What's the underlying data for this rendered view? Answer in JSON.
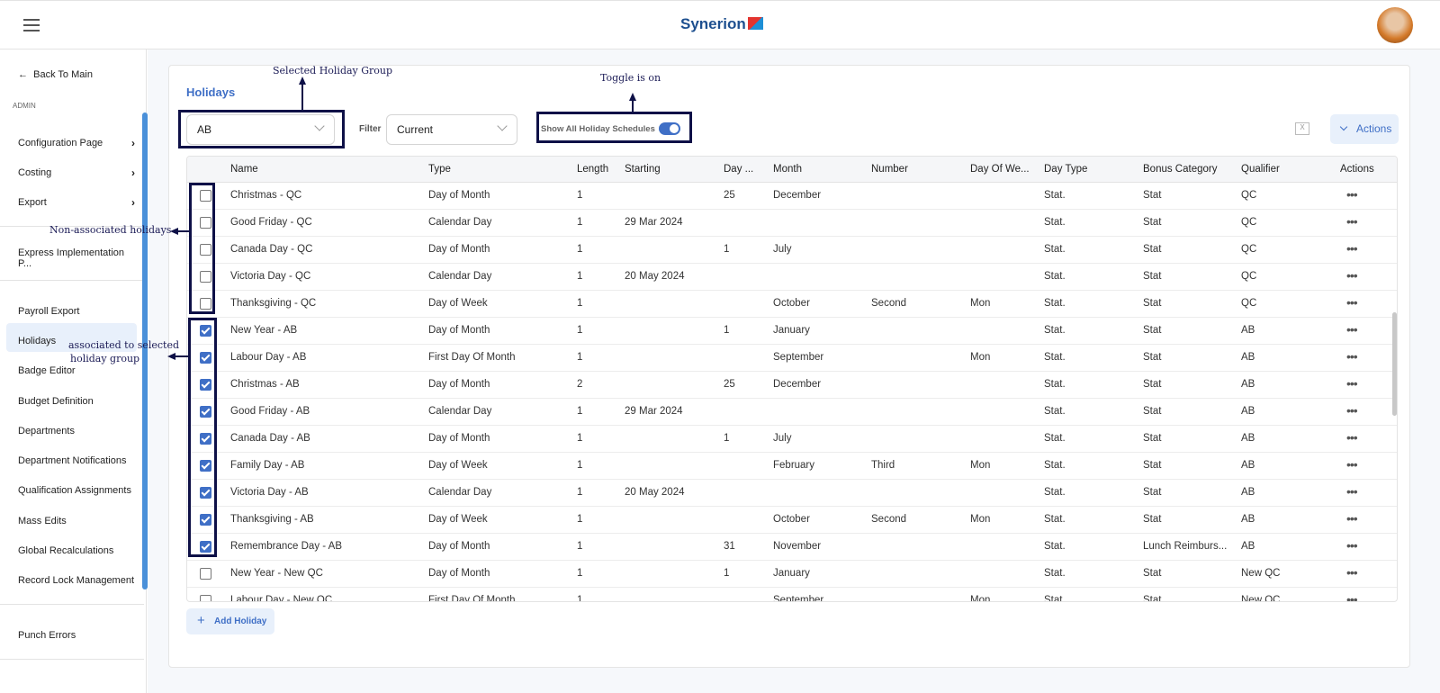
{
  "header": {
    "logo": "Synerion"
  },
  "sidebar": {
    "back": "Back To Main",
    "section": "ADMIN",
    "items": [
      {
        "label": "Configuration Page",
        "chev": "›"
      },
      {
        "label": "Costing",
        "chev": "›"
      },
      {
        "label": "Export",
        "chev": "›"
      },
      {
        "label": "Express Implementation P..."
      },
      {
        "label": "Payroll Export"
      },
      {
        "label": "Holidays"
      },
      {
        "label": "Badge Editor"
      },
      {
        "label": "Budget Definition"
      },
      {
        "label": "Departments"
      },
      {
        "label": "Department Notifications"
      },
      {
        "label": "Qualification Assignments"
      },
      {
        "label": "Mass Edits"
      },
      {
        "label": "Global Recalculations"
      },
      {
        "label": "Record Lock Management"
      },
      {
        "label": "Punch Errors"
      }
    ]
  },
  "page": {
    "title": "Holidays",
    "group": "AB",
    "filter_label": "Filter",
    "filter": "Current",
    "toggle_label": "Show All Holiday Schedules",
    "toggle_on": true,
    "actions": "Actions",
    "add": "Add Holiday",
    "excel": "X"
  },
  "table": {
    "columns": [
      "Name",
      "Type",
      "Length",
      "Starting",
      "Day ...",
      "Month",
      "Number",
      "Day Of We...",
      "Day Type",
      "Bonus Category",
      "Qualifier",
      "Actions"
    ],
    "rows": [
      {
        "checked": false,
        "c": [
          "Christmas - QC",
          "Day of Month",
          "1",
          "",
          "25",
          "December",
          "",
          "",
          "Stat.",
          "Stat",
          "QC"
        ]
      },
      {
        "checked": false,
        "c": [
          "Good Friday - QC",
          "Calendar Day",
          "1",
          "29 Mar 2024",
          "",
          "",
          "",
          "",
          "Stat.",
          "Stat",
          "QC"
        ]
      },
      {
        "checked": false,
        "c": [
          "Canada Day - QC",
          "Day of Month",
          "1",
          "",
          "1",
          "July",
          "",
          "",
          "Stat.",
          "Stat",
          "QC"
        ]
      },
      {
        "checked": false,
        "c": [
          "Victoria Day - QC",
          "Calendar Day",
          "1",
          "20 May 2024",
          "",
          "",
          "",
          "",
          "Stat.",
          "Stat",
          "QC"
        ]
      },
      {
        "checked": false,
        "c": [
          "Thanksgiving - QC",
          "Day of Week",
          "1",
          "",
          "",
          "October",
          "Second",
          "Mon",
          "Stat.",
          "Stat",
          "QC"
        ]
      },
      {
        "checked": true,
        "c": [
          "New Year - AB",
          "Day of Month",
          "1",
          "",
          "1",
          "January",
          "",
          "",
          "Stat.",
          "Stat",
          "AB"
        ]
      },
      {
        "checked": true,
        "c": [
          "Labour Day - AB",
          "First Day Of Month",
          "1",
          "",
          "",
          "September",
          "",
          "Mon",
          "Stat.",
          "Stat",
          "AB"
        ]
      },
      {
        "checked": true,
        "c": [
          "Christmas - AB",
          "Day of Month",
          "2",
          "",
          "25",
          "December",
          "",
          "",
          "Stat.",
          "Stat",
          "AB"
        ]
      },
      {
        "checked": true,
        "c": [
          "Good Friday - AB",
          "Calendar Day",
          "1",
          "29 Mar 2024",
          "",
          "",
          "",
          "",
          "Stat.",
          "Stat",
          "AB"
        ]
      },
      {
        "checked": true,
        "c": [
          "Canada Day - AB",
          "Day of Month",
          "1",
          "",
          "1",
          "July",
          "",
          "",
          "Stat.",
          "Stat",
          "AB"
        ]
      },
      {
        "checked": true,
        "c": [
          "Family Day - AB",
          "Day of Week",
          "1",
          "",
          "",
          "February",
          "Third",
          "Mon",
          "Stat.",
          "Stat",
          "AB"
        ]
      },
      {
        "checked": true,
        "c": [
          "Victoria Day - AB",
          "Calendar Day",
          "1",
          "20 May 2024",
          "",
          "",
          "",
          "",
          "Stat.",
          "Stat",
          "AB"
        ]
      },
      {
        "checked": true,
        "c": [
          "Thanksgiving - AB",
          "Day of Week",
          "1",
          "",
          "",
          "October",
          "Second",
          "Mon",
          "Stat.",
          "Stat",
          "AB"
        ]
      },
      {
        "checked": true,
        "c": [
          "Remembrance Day - AB",
          "Day of Month",
          "1",
          "",
          "31",
          "November",
          "",
          "",
          "Stat.",
          "Lunch Reimburs...",
          "AB"
        ]
      },
      {
        "checked": false,
        "c": [
          "New Year - New QC",
          "Day of Month",
          "1",
          "",
          "1",
          "January",
          "",
          "",
          "Stat.",
          "Stat",
          "New QC"
        ]
      },
      {
        "checked": false,
        "c": [
          "Labour Day - New QC",
          "First Day Of Month",
          "1",
          "",
          "",
          "September",
          "",
          "Mon",
          "Stat.",
          "Stat",
          "New QC"
        ]
      }
    ]
  },
  "annotations": {
    "group": "Selected Holiday Group",
    "toggle": "Toggle is on",
    "non_assoc": "Non-associated holidays",
    "assoc1": "associated to selected",
    "assoc2": "holiday group"
  },
  "colors": {
    "accent": "#3f6fc6",
    "annotation": "#0e1047"
  }
}
